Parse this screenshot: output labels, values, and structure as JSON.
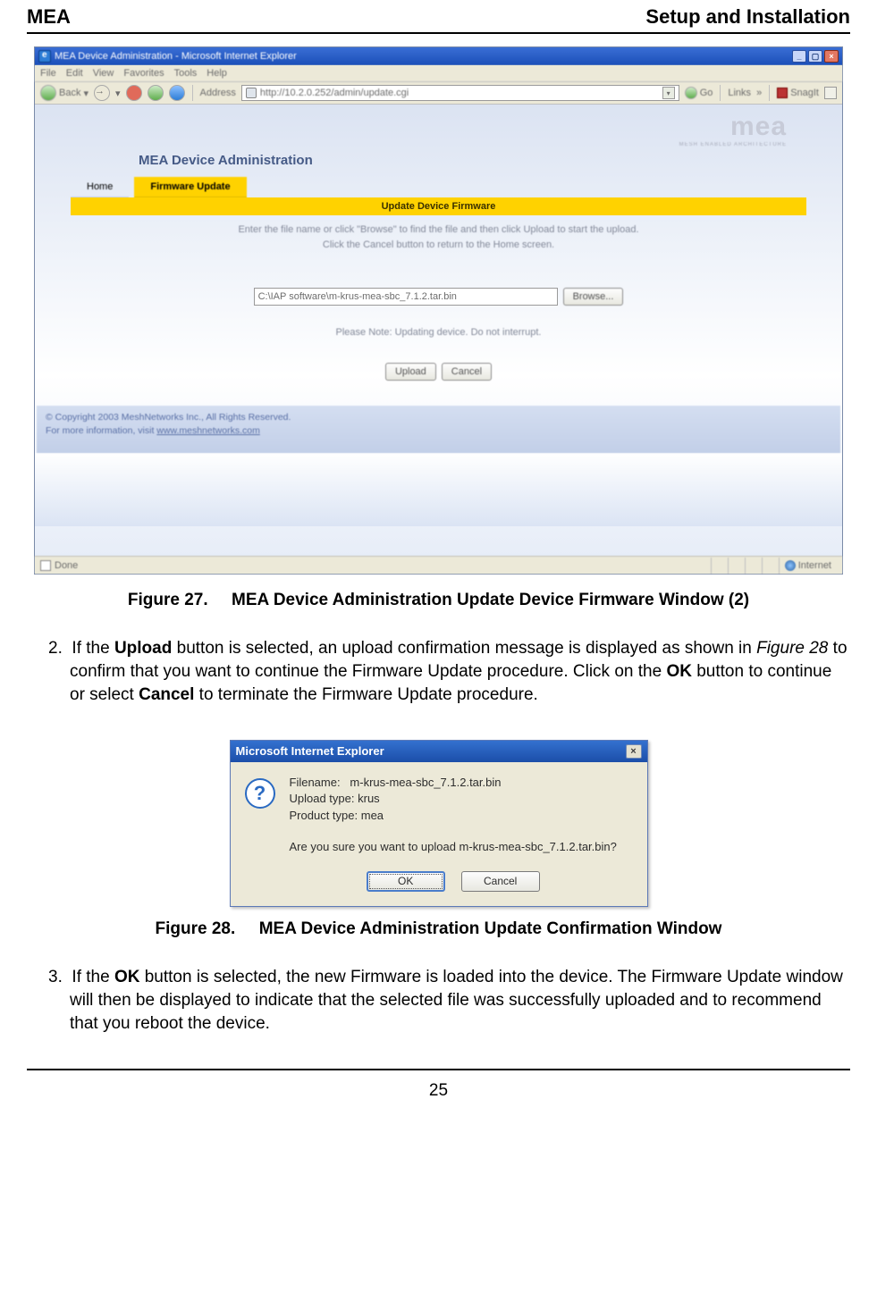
{
  "header": {
    "left": "MEA",
    "right": "Setup and Installation"
  },
  "browser": {
    "window_title": "MEA Device Administration - Microsoft Internet Explorer",
    "menu": [
      "File",
      "Edit",
      "View",
      "Favorites",
      "Tools",
      "Help"
    ],
    "back_label": "Back",
    "address_label": "Address",
    "address_value": "http://10.2.0.252/admin/update.cgi",
    "go_label": "Go",
    "links_label": "Links",
    "snagit_label": "SnagIt",
    "status_left": "Done",
    "status_right": "Internet"
  },
  "panel": {
    "logo_main": "mea",
    "logo_sub": "MESH ENABLED ARCHITECTURE",
    "page_title": "MEA Device Administration",
    "tabs": {
      "home": "Home",
      "firmware": "Firmware Update"
    },
    "section_header": "Update Device Firmware",
    "instr1": "Enter the file name or click \"Browse\" to find the file and then click Upload to start the upload.",
    "instr2": "Click the Cancel button to return to the Home screen.",
    "file_value": "C:\\IAP software\\m-krus-mea-sbc_7.1.2.tar.bin",
    "browse": "Browse...",
    "note": "Please Note: Updating device. Do not interrupt.",
    "upload": "Upload",
    "cancel": "Cancel",
    "copyright": "© Copyright 2003 MeshNetworks Inc., All Rights Reserved.",
    "moreinfo_pre": "For more information, visit ",
    "moreinfo_link": "www.meshnetworks.com"
  },
  "caption1": {
    "label": "Figure 27.",
    "text": "MEA Device Administration Update Device Firmware Window (2)"
  },
  "step2": {
    "num": "2.",
    "pre": "If the ",
    "b1": "Upload",
    "mid1": " button is selected, an upload confirmation message is displayed as shown in ",
    "i1": "Figure 28",
    "mid2": " to confirm that you want to continue the Firmware Update procedure.  Click on the ",
    "b2": "OK",
    "mid3": " button to continue or select ",
    "b3": "Cancel",
    "post": " to terminate the Firmware Update procedure."
  },
  "dialog": {
    "title": "Microsoft Internet Explorer",
    "line_filename_label": "Filename:",
    "line_filename_value": "m-krus-mea-sbc_7.1.2.tar.bin",
    "line_uploadtype_label": "Upload type:",
    "line_uploadtype_value": "krus",
    "line_producttype_label": "Product type:",
    "line_producttype_value": "mea",
    "question": "Are you sure you want to upload m-krus-mea-sbc_7.1.2.tar.bin?",
    "ok": "OK",
    "cancel": "Cancel"
  },
  "caption2": {
    "label": "Figure 28.",
    "text": "MEA Device Administration Update Confirmation Window"
  },
  "step3": {
    "num": "3.",
    "pre": "If the ",
    "b1": "OK",
    "post": " button is selected, the new Firmware is loaded into the device.  The Firmware Update window will then be displayed to indicate that the selected file was successfully uploaded and to recommend that you reboot the device."
  },
  "page_number": "25"
}
